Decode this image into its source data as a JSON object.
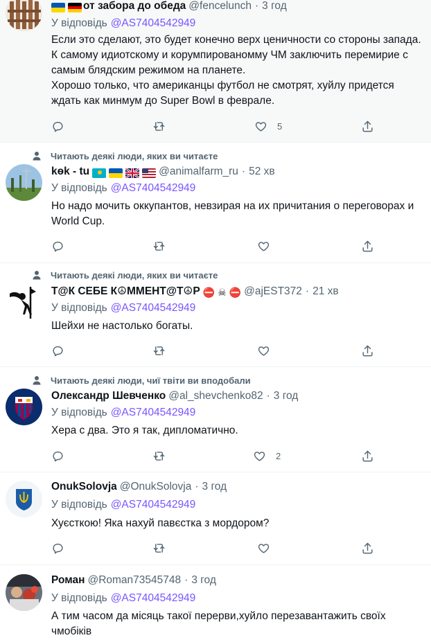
{
  "colors": {
    "link": "#7856ff",
    "secondary": "#536471",
    "text": "#0f1419",
    "divider": "#eff3f4"
  },
  "tweets": [
    {
      "name": "от забора до обеда",
      "handle": "@fencelunch",
      "time": "3 год",
      "social_context": "",
      "reply_prefix": "У відповідь",
      "reply_to": "@AS7404542949",
      "body": [
        "Если это сделают, это будет конечно верх ценичности со стороны запада. К самому идиотскому и корумпированомму ЧМ заключить перемирие с самым блядским режимом на планете.",
        "Хорошо только, что американцы футбол не смотрят, хуйлу придется ждать как минмум до Super Bowl в феврале."
      ],
      "likes": "5",
      "retweets": "",
      "replies": ""
    },
    {
      "name": "kѳk - tu",
      "handle": "@animalfarm_ru",
      "time": "52 хв",
      "social_context": "Читають деякі люди, яких ви читаєте",
      "reply_prefix": "У відповідь",
      "reply_to": "@AS7404542949",
      "body": [
        "Но надо мочить оккупантов, невзирая на их причитания о переговорах и World Cup."
      ],
      "likes": "",
      "retweets": "",
      "replies": ""
    },
    {
      "name": "Т@К СЕБЕ К☮ММЕНТ@Т☮Р",
      "handle": "@ajEST372",
      "time": "21 хв",
      "social_context": "Читають деякі люди, яких ви читаєте",
      "reply_prefix": "У відповідь",
      "reply_to": "@AS7404542949",
      "body": [
        "Шейхи не настолько богаты."
      ],
      "likes": "",
      "retweets": "",
      "replies": ""
    },
    {
      "name": "Олександр Шевченко",
      "handle": "@al_shevchenko82",
      "time": "3 год",
      "social_context": "Читають деякі люди, чиї твіти ви вподобали",
      "reply_prefix": "У відповідь",
      "reply_to": "@AS7404542949",
      "body": [
        "Хера с два. Это я так, дипломатично."
      ],
      "likes": "2",
      "retweets": "",
      "replies": ""
    },
    {
      "name": "OnukSolovja",
      "handle": "@OnukSolovja",
      "time": "3 год",
      "social_context": "",
      "reply_prefix": "У відповідь",
      "reply_to": "@AS7404542949",
      "body": [
        "Хуєсткою! Яка нахуй павєстка з мордором?"
      ],
      "likes": "",
      "retweets": "",
      "replies": ""
    },
    {
      "name": "Роман",
      "handle": "@Roman73545748",
      "time": "3 год",
      "social_context": "",
      "reply_prefix": "У відповідь",
      "reply_to": "@AS7404542949",
      "body": [
        "А тим часом да місяць такої перерви,хуйло перезавантажить своїх чмобіків"
      ],
      "likes": "",
      "retweets": "",
      "replies": ""
    }
  ]
}
